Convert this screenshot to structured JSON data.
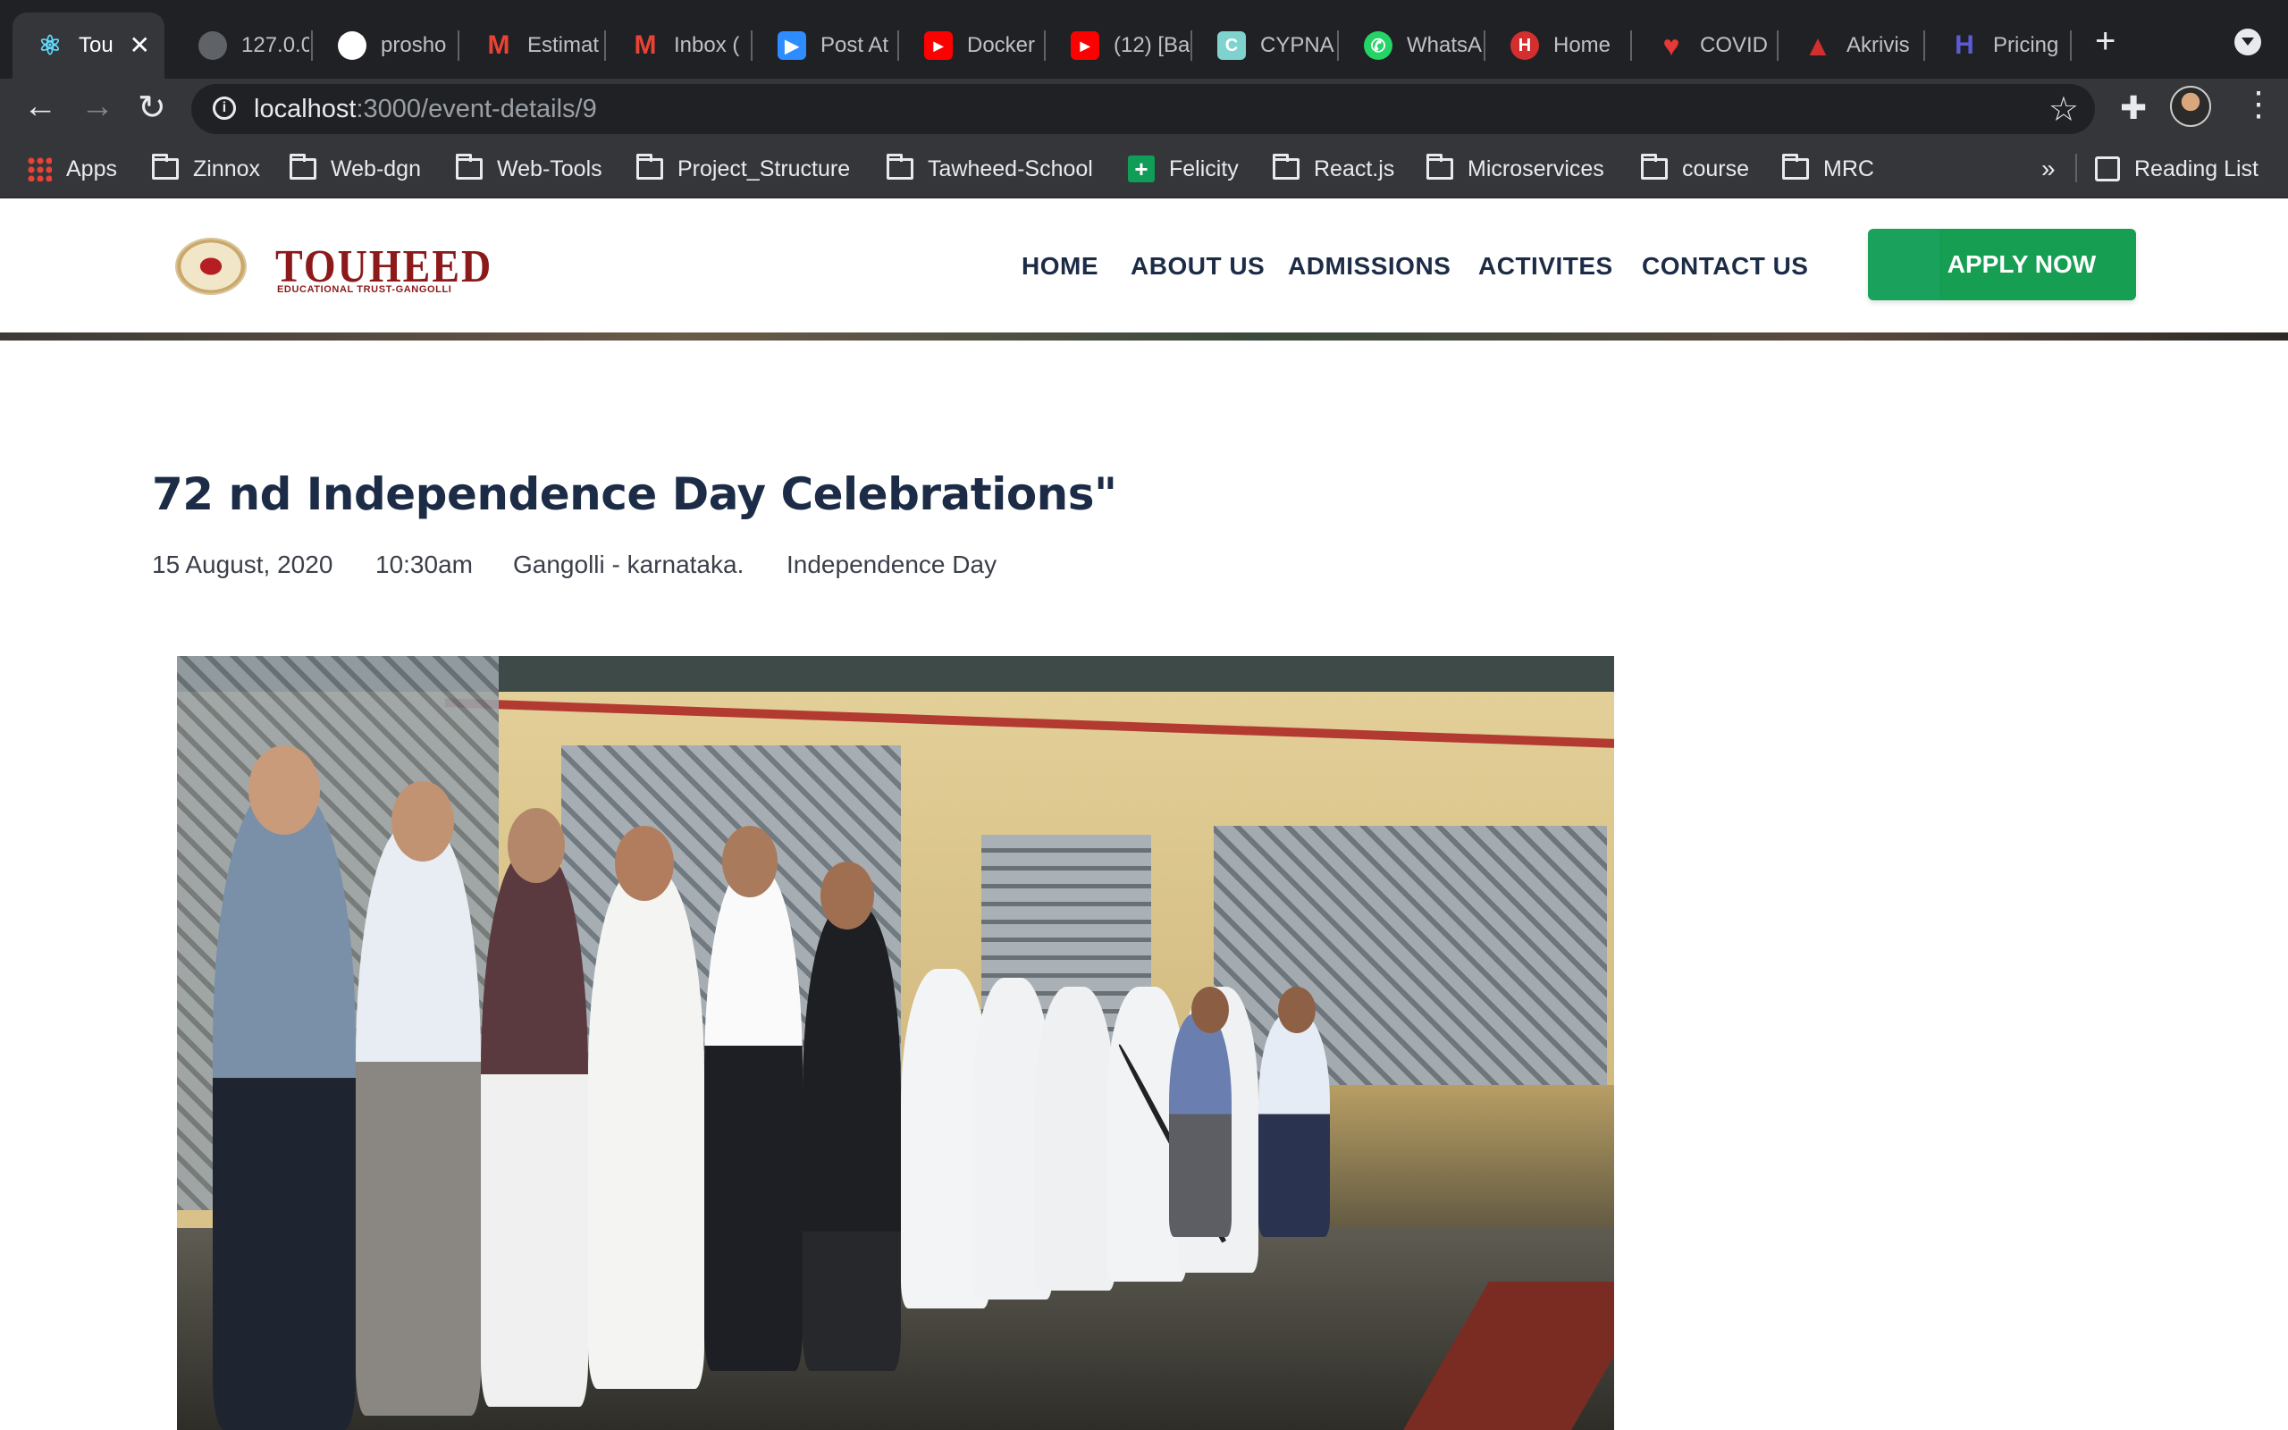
{
  "browser": {
    "tabs": [
      {
        "title": "Tou",
        "favicon": "react-icon",
        "color": "#61dafb",
        "active": true
      },
      {
        "title": "127.0.0",
        "favicon": "globe-icon",
        "color": "#9aa0a6"
      },
      {
        "title": "prosho",
        "favicon": "github-icon",
        "color": "#ffffff"
      },
      {
        "title": "Estimat",
        "favicon": "gmail-icon",
        "color": "#ea4335"
      },
      {
        "title": "Inbox (",
        "favicon": "gmail-icon",
        "color": "#ea4335"
      },
      {
        "title": "Post At",
        "favicon": "zoom-icon",
        "color": "#2d8cff"
      },
      {
        "title": "Docker",
        "favicon": "youtube-icon",
        "color": "#ff0000"
      },
      {
        "title": "(12) [Ba",
        "favicon": "youtube-icon",
        "color": "#ff0000"
      },
      {
        "title": "CYPNA",
        "favicon": "c-icon",
        "color": "#7fd3cf"
      },
      {
        "title": "WhatsA",
        "favicon": "whatsapp-icon",
        "color": "#25d366"
      },
      {
        "title": "Home",
        "favicon": "h-icon",
        "color": "#d32f2f"
      },
      {
        "title": "COVID",
        "favicon": "heart-icon",
        "color": "#e53935"
      },
      {
        "title": "Akrivis",
        "favicon": "a-icon",
        "color": "#d32f2f"
      },
      {
        "title": "Pricing",
        "favicon": "h-icon",
        "color": "#5b5bd6"
      }
    ],
    "url_host": "localhost",
    "url_rest": ":3000/event-details/9",
    "bookmarks": [
      {
        "label": "Apps",
        "icon": "apps-grid-icon"
      },
      {
        "label": "Zinnox",
        "icon": "folder-icon"
      },
      {
        "label": "Web-dgn",
        "icon": "folder-icon"
      },
      {
        "label": "Web-Tools",
        "icon": "folder-icon"
      },
      {
        "label": "Project_Structure",
        "icon": "folder-icon"
      },
      {
        "label": "Tawheed-School",
        "icon": "folder-icon"
      },
      {
        "label": "Felicity",
        "icon": "felicity-icon"
      },
      {
        "label": "React.js",
        "icon": "folder-icon"
      },
      {
        "label": "Microservices",
        "icon": "folder-icon"
      },
      {
        "label": "course",
        "icon": "folder-icon"
      },
      {
        "label": "MRC",
        "icon": "folder-icon"
      }
    ],
    "overflow": "»",
    "reading_list": "Reading List"
  },
  "site": {
    "logo_name": "TOUHEED",
    "logo_sub": "EDUCATIONAL TRUST-GANGOLLI",
    "nav": [
      "HOME",
      "ABOUT US",
      "ADMISSIONS",
      "ACTIVITES",
      "CONTACT US"
    ],
    "apply": "APPLY NOW",
    "brand_green": "#169e52",
    "brand_maroon": "#8c1a1a"
  },
  "event": {
    "title": "72 nd Independence Day Celebrations\"",
    "date": "15 August, 2020",
    "time": "10:30am",
    "location": "Gangolli - karnataka.",
    "category": "Independence Day"
  }
}
